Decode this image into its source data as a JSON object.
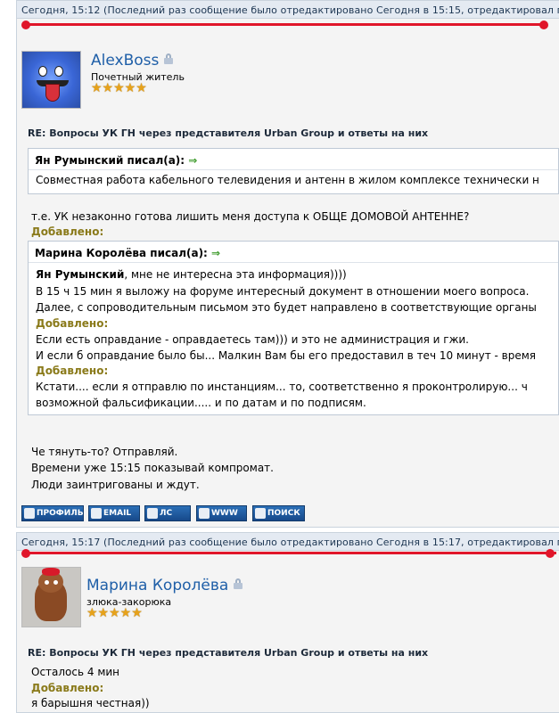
{
  "post1": {
    "header": "Сегодня, 15:12 (Последний раз сообщение было отредактировано Сегодня в 15:15, отредактировал пол",
    "author": "AlexBoss",
    "rank": "Почетный житель",
    "stars": "★★★★★",
    "title": "RE: Вопросы УК ГН через представителя Urban Group и ответы на них",
    "quote1_head": "Ян Румынский писал(а):",
    "quote1_text": "Совместная работа кабельного телевидения и антенн в жилом комплексе технически н",
    "text1": "т.е. УК незаконно готова лишить меня доступа к ОБЩЕ ДОМОВОЙ АНТЕННЕ?",
    "added": "Добавлено:",
    "quote2_head": "Марина Королёва писал(а):",
    "quote2_name": "Ян Румынский",
    "quote2_lines": [
      ", мне не интересна эта информация))))",
      "В 15 ч 15 мин я выложу на форуме интересный документ в отношении моего вопроса.",
      "Далее, с сопроводительным письмом это будет направлено в соответствующие органы",
      "Если есть оправдание - оправдаетесь там))) и это не администрация и гжи.",
      "И если б оправдание было бы... Малкин Вам бы его предоставил в теч 10 минут - время",
      "Кстати.... если я отправлю по инстанциям... то, соответственно я проконтролирую... ч",
      "возможной фальсификации..... и по датам и по подписям."
    ],
    "tail_lines": [
      "Че тянуть-то? Отправляй.",
      "Времени уже 15:15 показывай компромат.",
      "Люди заинтригованы и ждут."
    ],
    "buttons": [
      "ПРОФИЛЬ",
      "EMAIL",
      "ЛС",
      "WWW",
      "ПОИСК"
    ]
  },
  "post2": {
    "header": "Сегодня, 15:17 (Последний раз сообщение было отредактировано Сегодня в 15:17, отредактировал пол",
    "author": "Марина Королёва",
    "rank": "злюка-закорюка",
    "stars": "★★★★★",
    "title": "RE: Вопросы УК ГН через представителя Urban Group и ответы на них",
    "line1": "Осталось 4 мин",
    "added": "Добавлено:",
    "line2": "я барышня честная))"
  },
  "colors": {
    "accent_red": "#e0162a",
    "author_blue": "#1f5fa8",
    "added_olive": "#8a7a1a",
    "button_blue": "#17498a"
  },
  "icons": [
    "lock-icon",
    "arrow-right-icon",
    "profile-icon",
    "email-icon",
    "message-icon",
    "www-icon",
    "search-icon"
  ]
}
